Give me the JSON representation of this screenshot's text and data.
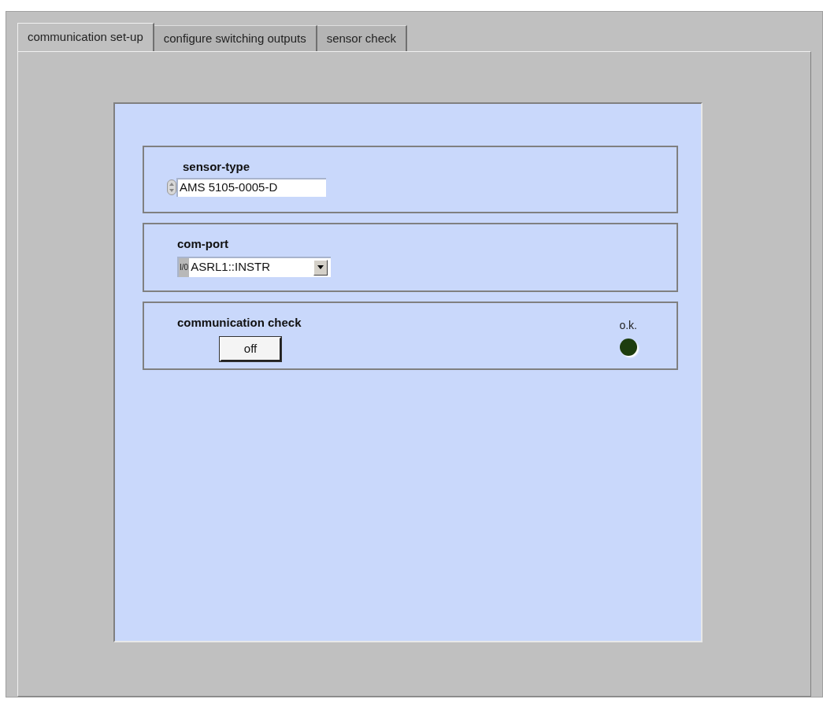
{
  "tabs": [
    {
      "label": "communication set-up",
      "selected": true
    },
    {
      "label": "configure switching outputs",
      "selected": false
    },
    {
      "label": "sensor check",
      "selected": false
    }
  ],
  "sensor_type": {
    "label": "sensor-type",
    "value": "AMS 5105-0005-D"
  },
  "com_port": {
    "label": "com-port",
    "io_glyph": "I/0",
    "value": "ASRL1::INSTR"
  },
  "communication_check": {
    "label": "communication check",
    "button": "off",
    "indicator": {
      "label": "o.k.",
      "on": false
    }
  }
}
